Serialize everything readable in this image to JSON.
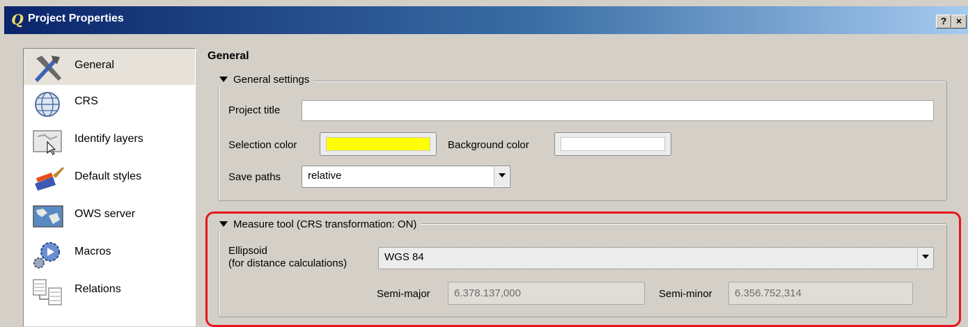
{
  "window": {
    "title": "Project Properties",
    "help_label": "?",
    "close_label": "×"
  },
  "sidebar": {
    "items": [
      {
        "label": "General",
        "icon": "tools-icon",
        "selected": true
      },
      {
        "label": "CRS",
        "icon": "globe-icon"
      },
      {
        "label": "Identify layers",
        "icon": "identify-layers-icon"
      },
      {
        "label": "Default styles",
        "icon": "paintbrush-icon"
      },
      {
        "label": "OWS server",
        "icon": "map-server-icon"
      },
      {
        "label": "Macros",
        "icon": "gears-icon"
      },
      {
        "label": "Relations",
        "icon": "relations-icon"
      }
    ]
  },
  "main": {
    "section_title": "General",
    "general_settings": {
      "legend": "General settings",
      "project_title_label": "Project title",
      "project_title_value": "",
      "selection_color_label": "Selection color",
      "selection_color": "#ffff00",
      "background_color_label": "Background color",
      "background_color": "#ffffff",
      "save_paths_label": "Save paths",
      "save_paths_value": "relative"
    },
    "measure_tool": {
      "legend": "Measure tool (CRS transformation: ON)",
      "ellipsoid_label_line1": "Ellipsoid",
      "ellipsoid_label_line2": "(for distance calculations)",
      "ellipsoid_value": "WGS 84",
      "semi_major_label": "Semi-major",
      "semi_major_value": "6.378.137,000",
      "semi_minor_label": "Semi-minor",
      "semi_minor_value": "6.356.752,314"
    }
  },
  "colors": {
    "highlight": "#e8141c",
    "titlebar": "#0a246a"
  }
}
